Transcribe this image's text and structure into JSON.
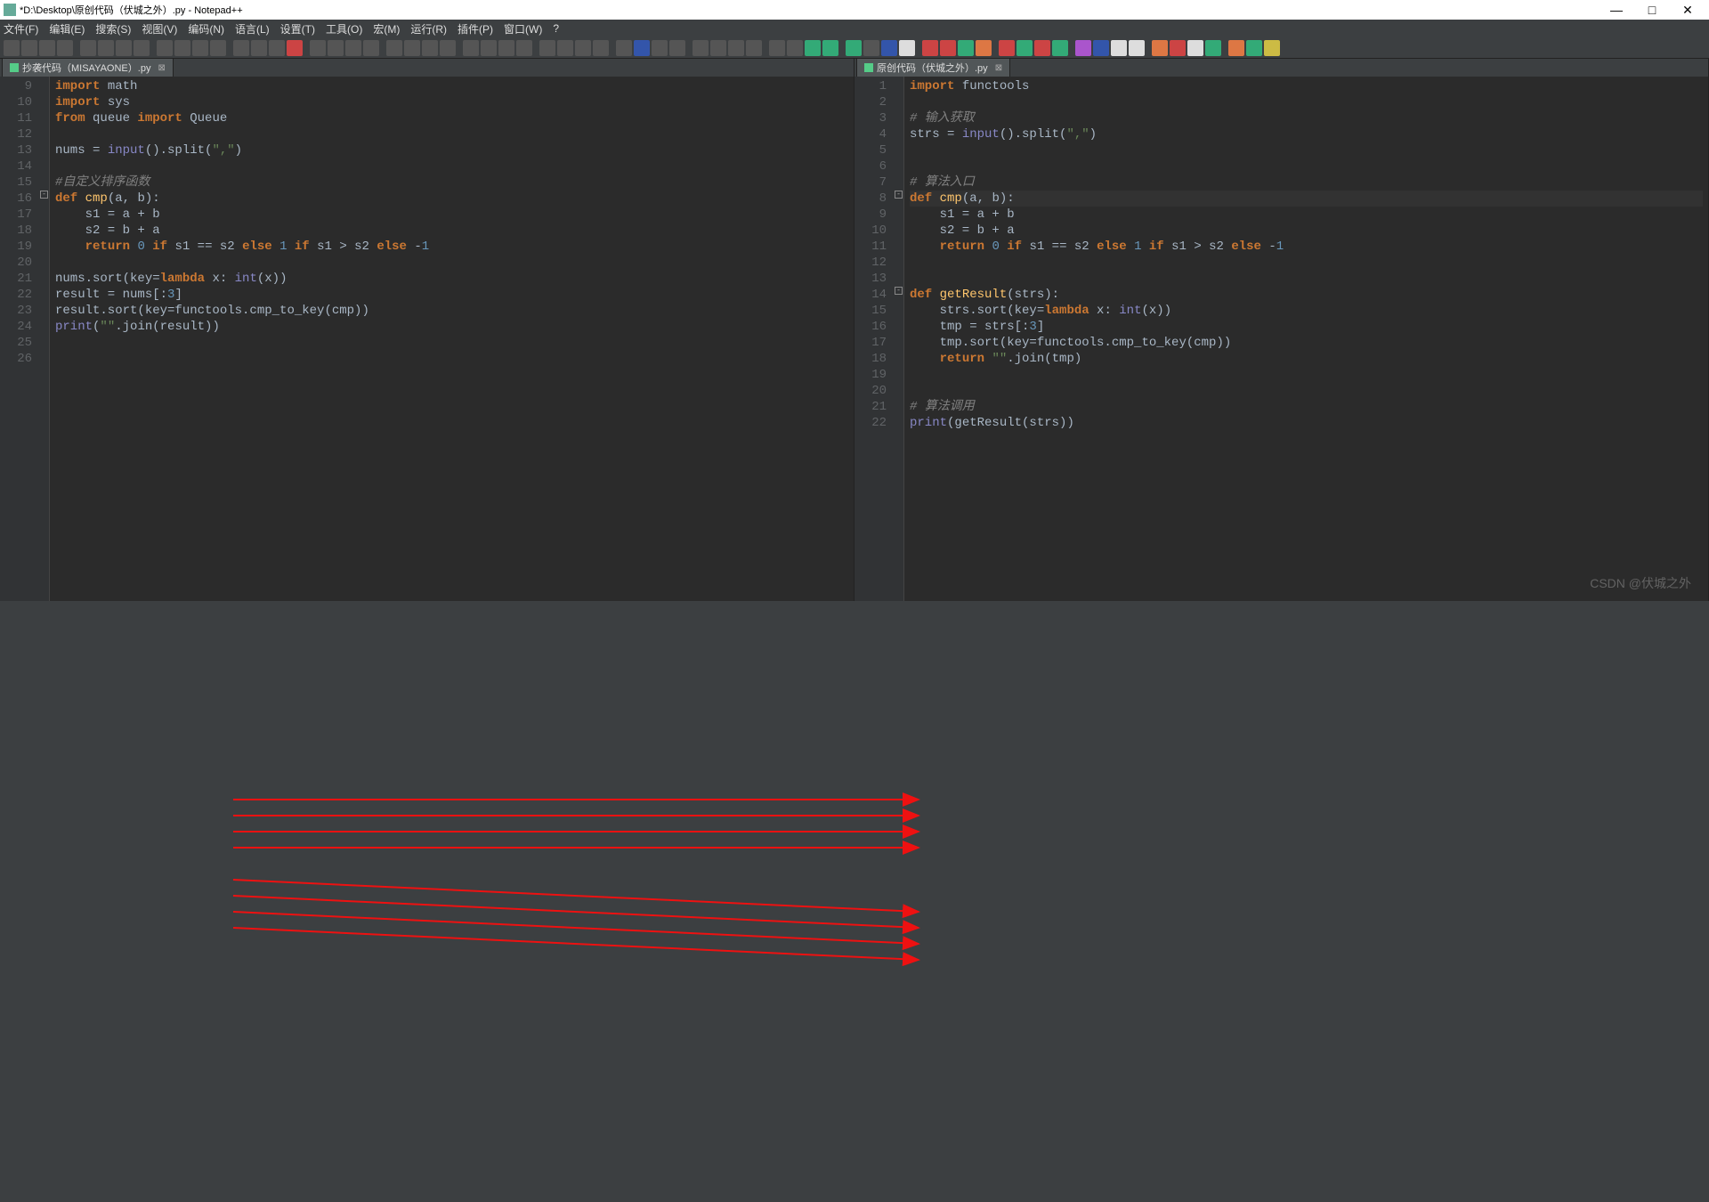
{
  "window": {
    "title": "*D:\\Desktop\\原创代码（伏城之外）.py - Notepad++",
    "min": "—",
    "max": "□",
    "close": "✕"
  },
  "menu": {
    "items": [
      "文件(F)",
      "编辑(E)",
      "搜索(S)",
      "视图(V)",
      "编码(N)",
      "语言(L)",
      "设置(T)",
      "工具(O)",
      "宏(M)",
      "运行(R)",
      "插件(P)",
      "窗口(W)",
      "?"
    ]
  },
  "tabs": {
    "left": {
      "label": "抄袭代码（MISAYAONE）.py",
      "close": "⊠"
    },
    "right": {
      "label": "原创代码（伏城之外）.py",
      "close": "⊠"
    }
  },
  "left_lines": [
    "9",
    "10",
    "11",
    "12",
    "13",
    "14",
    "15",
    "16",
    "17",
    "18",
    "19",
    "20",
    "21",
    "22",
    "23",
    "24",
    "25",
    "26"
  ],
  "right_lines": [
    "1",
    "2",
    "3",
    "4",
    "5",
    "6",
    "7",
    "8",
    "9",
    "10",
    "11",
    "12",
    "13",
    "14",
    "15",
    "16",
    "17",
    "18",
    "19",
    "20",
    "21",
    "22"
  ],
  "left_code": {
    "l9": {
      "pre": "",
      "tokens": [
        {
          "t": "import",
          "c": "kw"
        },
        {
          "t": " math",
          "c": ""
        }
      ]
    },
    "l10": {
      "pre": "",
      "tokens": [
        {
          "t": "import",
          "c": "kw"
        },
        {
          "t": " sys",
          "c": ""
        }
      ]
    },
    "l11": {
      "pre": "",
      "tokens": [
        {
          "t": "from",
          "c": "kw"
        },
        {
          "t": " queue ",
          "c": ""
        },
        {
          "t": "import",
          "c": "kw"
        },
        {
          "t": " Queue",
          "c": ""
        }
      ]
    },
    "l12": {
      "pre": "",
      "tokens": []
    },
    "l13": {
      "pre": "",
      "tokens": [
        {
          "t": "nums = ",
          "c": ""
        },
        {
          "t": "input",
          "c": "bi"
        },
        {
          "t": "().split(",
          "c": ""
        },
        {
          "t": "\",\"",
          "c": "str"
        },
        {
          "t": ")",
          "c": ""
        }
      ]
    },
    "l14": {
      "pre": "",
      "tokens": []
    },
    "l15": {
      "pre": "",
      "tokens": [
        {
          "t": "#自定义排序函数",
          "c": "cm"
        }
      ]
    },
    "l16": {
      "pre": "",
      "tokens": [
        {
          "t": "def",
          "c": "kw"
        },
        {
          "t": " ",
          "c": ""
        },
        {
          "t": "cmp",
          "c": "fn"
        },
        {
          "t": "(a, b):",
          "c": ""
        }
      ]
    },
    "l17": {
      "pre": "    ",
      "tokens": [
        {
          "t": "s1 = a + b",
          "c": ""
        }
      ]
    },
    "l18": {
      "pre": "    ",
      "tokens": [
        {
          "t": "s2 = b + a",
          "c": ""
        }
      ]
    },
    "l19": {
      "pre": "    ",
      "tokens": [
        {
          "t": "return",
          "c": "kw"
        },
        {
          "t": " ",
          "c": ""
        },
        {
          "t": "0",
          "c": "num"
        },
        {
          "t": " ",
          "c": ""
        },
        {
          "t": "if",
          "c": "kw"
        },
        {
          "t": " s1 == s2 ",
          "c": ""
        },
        {
          "t": "else",
          "c": "kw"
        },
        {
          "t": " ",
          "c": ""
        },
        {
          "t": "1",
          "c": "num"
        },
        {
          "t": " ",
          "c": ""
        },
        {
          "t": "if",
          "c": "kw"
        },
        {
          "t": " s1 > s2 ",
          "c": ""
        },
        {
          "t": "else",
          "c": "kw"
        },
        {
          "t": " -",
          "c": ""
        },
        {
          "t": "1",
          "c": "num"
        }
      ]
    },
    "l20": {
      "pre": "",
      "tokens": []
    },
    "l21": {
      "pre": "",
      "tokens": [
        {
          "t": "nums.sort(key=",
          "c": ""
        },
        {
          "t": "lambda",
          "c": "kw"
        },
        {
          "t": " x: ",
          "c": ""
        },
        {
          "t": "int",
          "c": "bi"
        },
        {
          "t": "(x))",
          "c": ""
        }
      ]
    },
    "l22": {
      "pre": "",
      "tokens": [
        {
          "t": "result = nums[:",
          "c": ""
        },
        {
          "t": "3",
          "c": "num"
        },
        {
          "t": "]",
          "c": ""
        }
      ]
    },
    "l23": {
      "pre": "",
      "tokens": [
        {
          "t": "result.sort(key=functools.cmp_to_key(cmp))",
          "c": ""
        }
      ]
    },
    "l24": {
      "pre": "",
      "tokens": [
        {
          "t": "print",
          "c": "bi"
        },
        {
          "t": "(",
          "c": ""
        },
        {
          "t": "\"\"",
          "c": "str"
        },
        {
          "t": ".join(result))",
          "c": ""
        }
      ]
    },
    "l25": {
      "pre": "",
      "tokens": []
    },
    "l26": {
      "pre": "",
      "tokens": []
    }
  },
  "right_code": {
    "r1": {
      "pre": "",
      "tokens": [
        {
          "t": "import",
          "c": "kw"
        },
        {
          "t": " functools",
          "c": ""
        }
      ]
    },
    "r2": {
      "pre": "",
      "tokens": []
    },
    "r3": {
      "pre": "",
      "tokens": [
        {
          "t": "# 输入获取",
          "c": "cm"
        }
      ]
    },
    "r4": {
      "pre": "",
      "tokens": [
        {
          "t": "strs = ",
          "c": ""
        },
        {
          "t": "input",
          "c": "bi"
        },
        {
          "t": "().split(",
          "c": ""
        },
        {
          "t": "\",\"",
          "c": "str"
        },
        {
          "t": ")",
          "c": ""
        }
      ]
    },
    "r5": {
      "pre": "",
      "tokens": []
    },
    "r6": {
      "pre": "",
      "tokens": []
    },
    "r7": {
      "pre": "",
      "tokens": [
        {
          "t": "# 算法入口",
          "c": "cm"
        }
      ]
    },
    "r8": {
      "pre": "",
      "tokens": [
        {
          "t": "def",
          "c": "kw"
        },
        {
          "t": " ",
          "c": ""
        },
        {
          "t": "cmp",
          "c": "fn"
        },
        {
          "t": "(a, b):",
          "c": ""
        }
      ]
    },
    "r9": {
      "pre": "    ",
      "tokens": [
        {
          "t": "s1 = a + b",
          "c": ""
        }
      ]
    },
    "r10": {
      "pre": "    ",
      "tokens": [
        {
          "t": "s2 = b + a",
          "c": ""
        }
      ]
    },
    "r11": {
      "pre": "    ",
      "tokens": [
        {
          "t": "return",
          "c": "kw"
        },
        {
          "t": " ",
          "c": ""
        },
        {
          "t": "0",
          "c": "num"
        },
        {
          "t": " ",
          "c": ""
        },
        {
          "t": "if",
          "c": "kw"
        },
        {
          "t": " s1 == s2 ",
          "c": ""
        },
        {
          "t": "else",
          "c": "kw"
        },
        {
          "t": " ",
          "c": ""
        },
        {
          "t": "1",
          "c": "num"
        },
        {
          "t": " ",
          "c": ""
        },
        {
          "t": "if",
          "c": "kw"
        },
        {
          "t": " s1 > s2 ",
          "c": ""
        },
        {
          "t": "else",
          "c": "kw"
        },
        {
          "t": " -",
          "c": ""
        },
        {
          "t": "1",
          "c": "num"
        }
      ]
    },
    "r12": {
      "pre": "",
      "tokens": []
    },
    "r13": {
      "pre": "",
      "tokens": []
    },
    "r14": {
      "pre": "",
      "tokens": [
        {
          "t": "def",
          "c": "kw"
        },
        {
          "t": " ",
          "c": ""
        },
        {
          "t": "getResult",
          "c": "fn"
        },
        {
          "t": "(strs):",
          "c": ""
        }
      ]
    },
    "r15": {
      "pre": "    ",
      "tokens": [
        {
          "t": "strs.sort(key=",
          "c": ""
        },
        {
          "t": "lambda",
          "c": "kw"
        },
        {
          "t": " x: ",
          "c": ""
        },
        {
          "t": "int",
          "c": "bi"
        },
        {
          "t": "(x))",
          "c": ""
        }
      ]
    },
    "r16": {
      "pre": "    ",
      "tokens": [
        {
          "t": "tmp = strs[:",
          "c": ""
        },
        {
          "t": "3",
          "c": "num"
        },
        {
          "t": "]",
          "c": ""
        }
      ]
    },
    "r17": {
      "pre": "    ",
      "tokens": [
        {
          "t": "tmp.sort(key=functools.cmp_to_key(cmp))",
          "c": ""
        }
      ]
    },
    "r18": {
      "pre": "    ",
      "tokens": [
        {
          "t": "return",
          "c": "kw"
        },
        {
          "t": " ",
          "c": ""
        },
        {
          "t": "\"\"",
          "c": "str"
        },
        {
          "t": ".join(tmp)",
          "c": ""
        }
      ]
    },
    "r19": {
      "pre": "",
      "tokens": []
    },
    "r20": {
      "pre": "",
      "tokens": []
    },
    "r21": {
      "pre": "",
      "tokens": [
        {
          "t": "# 算法调用",
          "c": "cm"
        }
      ]
    },
    "r22": {
      "pre": "",
      "tokens": [
        {
          "t": "print",
          "c": "bi"
        },
        {
          "t": "(getResult(strs))",
          "c": ""
        }
      ]
    }
  },
  "arrows": [
    {
      "from": "l16",
      "to": "r8"
    },
    {
      "from": "l17",
      "to": "r9"
    },
    {
      "from": "l18",
      "to": "r10"
    },
    {
      "from": "l19",
      "to": "r11"
    },
    {
      "from": "l21",
      "to": "r15"
    },
    {
      "from": "l22",
      "to": "r16"
    },
    {
      "from": "l23",
      "to": "r17"
    },
    {
      "from": "l24",
      "to": "r18"
    }
  ],
  "watermark": "CSDN @伏城之外"
}
